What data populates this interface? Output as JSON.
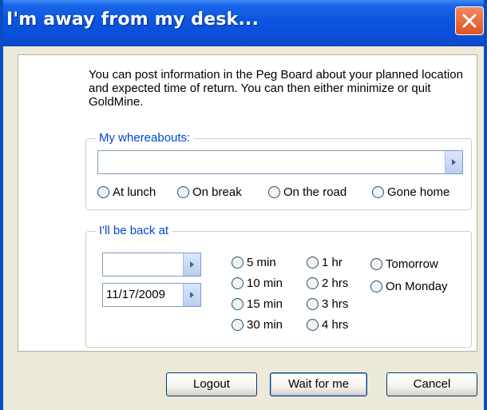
{
  "window": {
    "title": "I'm away from my desk...",
    "close_icon": "close-icon",
    "colors": {
      "titlebar": "#0b55df",
      "close": "#e0531f",
      "group_title": "#0046d5"
    }
  },
  "intro_text": "You can post information in the Peg Board about your planned location and expected time of return. You can then either minimize or quit GoldMine.",
  "whereabouts": {
    "title": "My whereabouts:",
    "value": "",
    "options": [
      "At lunch",
      "On break",
      "On the road",
      "Gone home"
    ]
  },
  "back_at": {
    "title": "I'll be back at",
    "time_value": "",
    "date_value": "11/17/2009",
    "col1": [
      "5 min",
      "10 min",
      "15 min",
      "30 min"
    ],
    "col2": [
      "1 hr",
      "2 hrs",
      "3 hrs",
      "4 hrs"
    ],
    "col3": [
      "Tomorrow",
      "On Monday"
    ]
  },
  "buttons": {
    "logout": "Logout",
    "wait": "Wait for me",
    "cancel": "Cancel"
  }
}
